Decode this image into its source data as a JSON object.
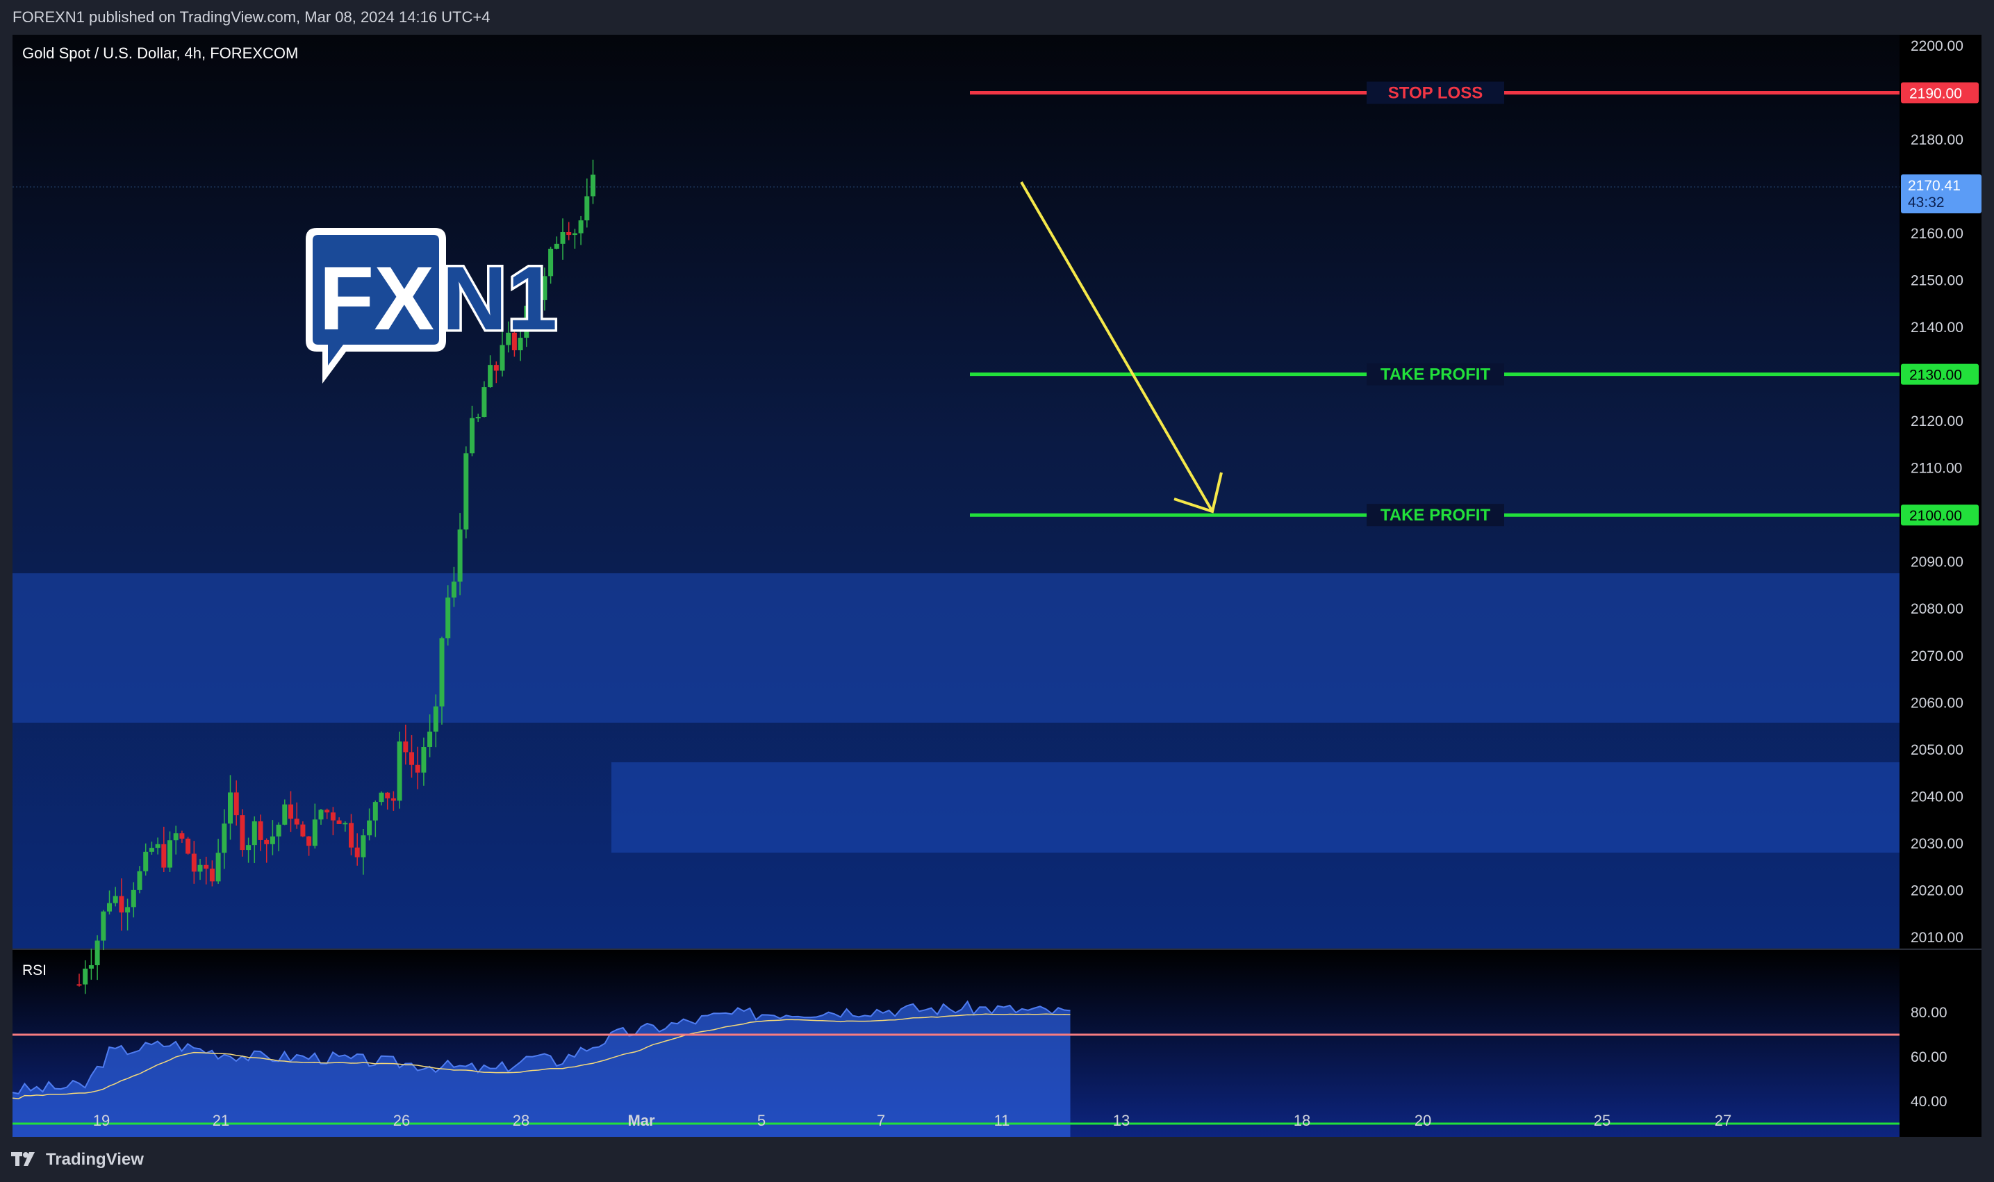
{
  "header": {
    "published": "FOREXN1 published on TradingView.com, Mar 08, 2024 14:16 UTC+4"
  },
  "chart": {
    "symbol_title": "Gold Spot / U.S. Dollar, 4h, FOREXCOM",
    "logo": {
      "fx": "FX",
      "n1": "N1"
    },
    "price_axis_labels": [
      "2200.00",
      "2180.00",
      "2170.41",
      "2160.00",
      "2150.00",
      "2140.00",
      "2120.00",
      "2110.00",
      "2090.00",
      "2080.00",
      "2070.00",
      "2060.00",
      "2050.00",
      "2040.00",
      "2030.00",
      "2020.00",
      "2010.00"
    ],
    "current_price": {
      "value": "2170.41",
      "countdown": "43:32",
      "color": "#5b9cf6"
    },
    "levels": [
      {
        "label": "STOP LOSS",
        "price": 2190,
        "price_label": "2190.00",
        "color": "#f23645"
      },
      {
        "label": "TAKE PROFIT",
        "price": 2130,
        "price_label": "2130.00",
        "color": "#22e03b"
      },
      {
        "label": "TAKE PROFIT",
        "price": 2100,
        "price_label": "2100.00",
        "color": "#22e03b"
      }
    ],
    "arrow_color": "#f5e84a",
    "zones_color": "#1c4bbd",
    "time_labels": [
      "19",
      "21",
      "26",
      "28",
      "Mar",
      "5",
      "7",
      "11",
      "13",
      "18",
      "20",
      "25",
      "27"
    ],
    "rsi": {
      "label": "RSI",
      "axis_labels": [
        "80.00",
        "60.00",
        "40.00"
      ],
      "overbought": 70,
      "oversold": 30,
      "upper_color": "#f77c80",
      "lower_color": "#22e03b"
    }
  },
  "footer": {
    "brand": "TradingView"
  }
}
